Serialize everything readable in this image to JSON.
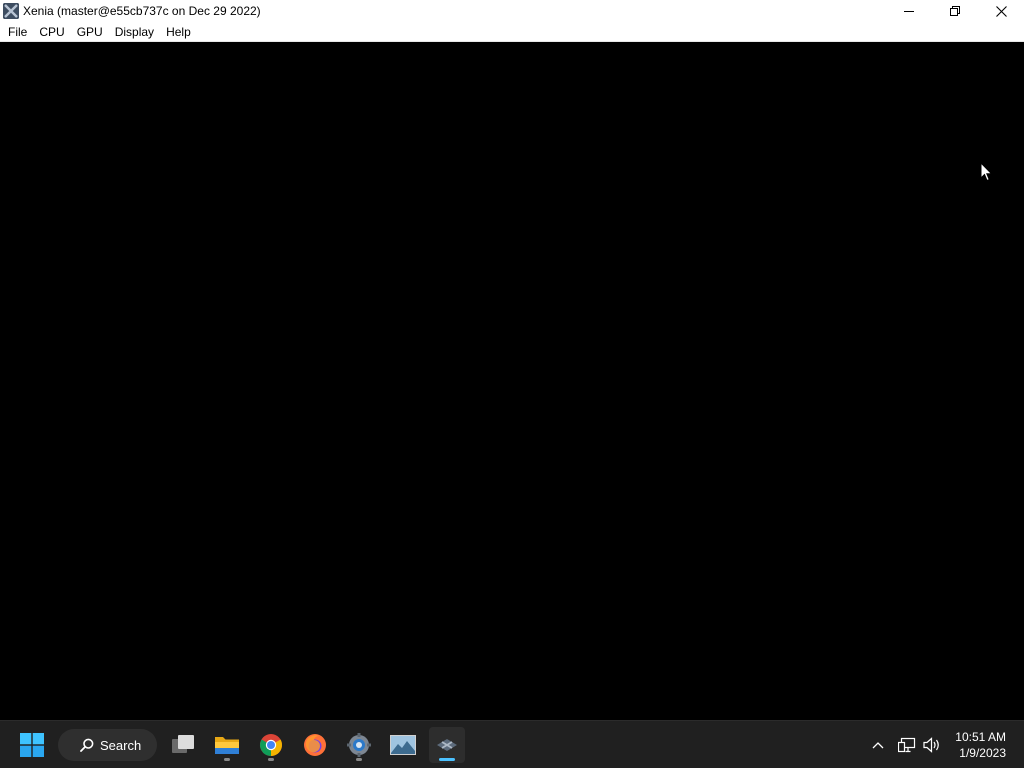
{
  "window": {
    "title": "Xenia (master@e55cb737c on Dec 29 2022)",
    "icon": "xenia-app-icon",
    "controls": [
      "minimize-icon",
      "restore-icon",
      "close-icon"
    ]
  },
  "menu": {
    "items": [
      {
        "label": "File"
      },
      {
        "label": "CPU"
      },
      {
        "label": "GPU"
      },
      {
        "label": "Display"
      },
      {
        "label": "Help"
      }
    ]
  },
  "content": {
    "background": "#000000"
  },
  "taskbar": {
    "background": "#202020",
    "accent": "#4cc2ff",
    "search_label": "Search",
    "apps": [
      {
        "name": "start-icon"
      },
      {
        "name": "task-view-icon"
      },
      {
        "name": "file-explorer-icon"
      },
      {
        "name": "chrome-icon"
      },
      {
        "name": "firefox-icon"
      },
      {
        "name": "settings-icon"
      },
      {
        "name": "image-viewer-icon"
      },
      {
        "name": "xenia-taskbar-icon",
        "active": true
      }
    ],
    "tray": {
      "icons": [
        "chevron-up-icon",
        "network-icon",
        "volume-icon"
      ],
      "time": "10:51 AM",
      "date": "1/9/2023"
    }
  }
}
